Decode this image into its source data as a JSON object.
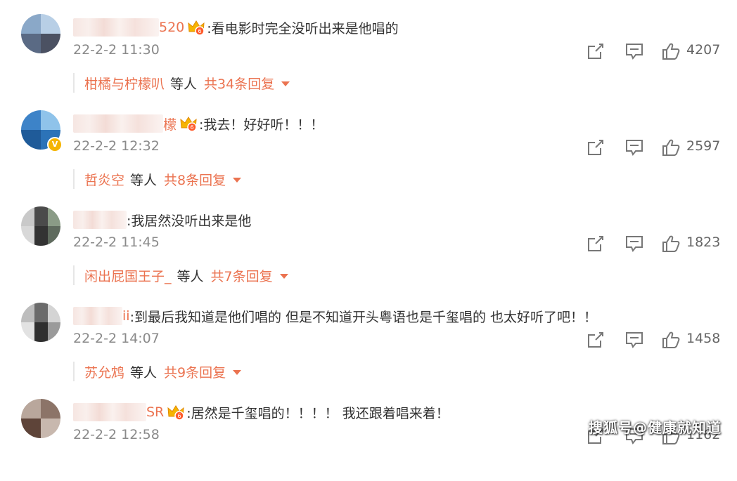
{
  "comments": [
    {
      "username_visible": "520",
      "text": ":看电影时完全没听出来是他唱的",
      "time": "22-2-2 11:30",
      "likes": "4207",
      "reply_user": "柑橘与柠檬叭",
      "reply_etc": "等人",
      "reply_total": "共34条回复"
    },
    {
      "username_visible": "檬",
      "text": ":我去！好好听！！！",
      "time": "22-2-2 12:32",
      "likes": "2597",
      "reply_user": "哲炎空",
      "reply_etc": "等人",
      "reply_total": "共8条回复"
    },
    {
      "username_visible": "",
      "text": ":我居然没听出来是他",
      "time": "22-2-2 11:45",
      "likes": "1823",
      "reply_user": "闲出屁国王子_",
      "reply_etc": "等人",
      "reply_total": "共7条回复"
    },
    {
      "username_visible": "ii",
      "text": ":到最后我知道是他们唱的 但是不知道开头粤语也是千玺唱的 也太好听了吧！！",
      "time": "22-2-2 14:07",
      "likes": "1458",
      "reply_user": "苏允鸩",
      "reply_etc": "等人",
      "reply_total": "共9条回复"
    },
    {
      "username_visible": "SR",
      "text": ":居然是千玺唱的！！！！ 我还跟着唱来着！",
      "time": "22-2-2 12:58",
      "likes": "1162"
    }
  ],
  "icons": {
    "share": "share-icon",
    "comment": "comment-icon",
    "like": "thumbs-up-icon",
    "crown": "crown-icon",
    "verified": "verified-badge-icon"
  },
  "colors": {
    "accent": "#eb7350",
    "text": "#333333",
    "meta": "#8a8a8a",
    "gold": "#f5b400"
  },
  "watermark": "搜狐号@健康就知道",
  "verified_mark": "V"
}
